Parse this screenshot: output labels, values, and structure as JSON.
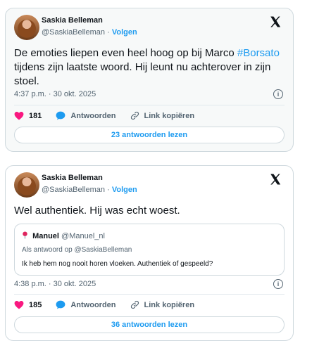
{
  "tweets": [
    {
      "author": "Saskia Belleman",
      "handle": "@SaskiaBelleman",
      "separator": "·",
      "follow": "Volgen",
      "text_before": "De emoties liepen even heel hoog op bij Marco ",
      "hashtag": "#Borsato",
      "text_after": " tijdens zijn laatste woord. Hij leunt nu achterover in zijn stoel.",
      "timestamp": "4:37 p.m. · 30 okt. 2025",
      "likes": "181",
      "reply_label": "Antwoorden",
      "copy_label": "Link kopiëren",
      "read_replies": "23 antwoorden lezen"
    },
    {
      "author": "Saskia Belleman",
      "handle": "@SaskiaBelleman",
      "separator": "·",
      "follow": "Volgen",
      "text": "Wel authentiek. Hij was echt woest.",
      "quote": {
        "name": "Manuel",
        "handle": "@Manuel_nl",
        "reply_to": "Als antwoord op @SaskiaBelleman",
        "text": "Ik heb hem nog nooit horen vloeken. Authentiek of gespeeld?"
      },
      "timestamp": "4:38 p.m. · 30 okt. 2025",
      "likes": "185",
      "reply_label": "Antwoorden",
      "copy_label": "Link kopiëren",
      "read_replies": "36 antwoorden lezen"
    }
  ],
  "colors": {
    "accent": "#1d9bf0",
    "like": "#f91880",
    "text": "#0f1419",
    "muted": "#536471"
  },
  "icons": [
    "x-logo-icon",
    "info-icon",
    "heart-icon",
    "reply-bubble-icon",
    "link-icon",
    "pin-icon"
  ]
}
